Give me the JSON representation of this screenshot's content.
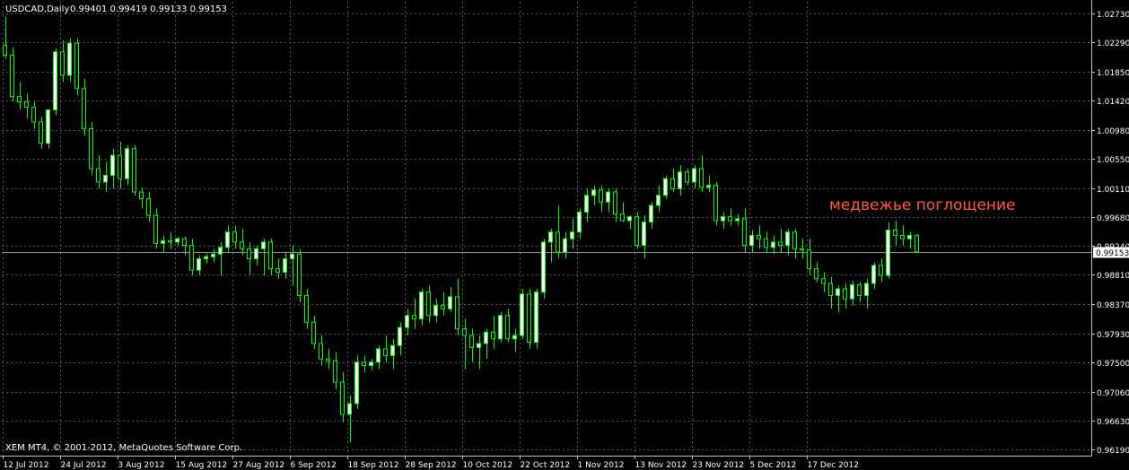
{
  "chart_data": {
    "type": "candlestick",
    "symbol_header": "USDCAD,Daily",
    "ohlc_header": "0.99401 0.99419 0.99133 0.99153",
    "current_price_label": "0.99153",
    "current_price": 0.99153,
    "ylim": [
      0.961,
      1.029
    ],
    "y_ticks": [
      {
        "value": 1.0273,
        "label": "1.02730"
      },
      {
        "value": 1.0229,
        "label": "1.02290"
      },
      {
        "value": 1.0185,
        "label": "1.01850"
      },
      {
        "value": 1.0142,
        "label": "1.01420"
      },
      {
        "value": 1.0098,
        "label": "1.00980"
      },
      {
        "value": 1.0055,
        "label": "1.00550"
      },
      {
        "value": 1.0011,
        "label": "1.00110"
      },
      {
        "value": 0.9968,
        "label": "0.99680"
      },
      {
        "value": 0.9924,
        "label": "0.99240"
      },
      {
        "value": 0.9881,
        "label": "0.98810"
      },
      {
        "value": 0.9837,
        "label": "0.98370"
      },
      {
        "value": 0.9793,
        "label": "0.97930"
      },
      {
        "value": 0.975,
        "label": "0.97500"
      },
      {
        "value": 0.9706,
        "label": "0.97060"
      },
      {
        "value": 0.9663,
        "label": "0.96630"
      },
      {
        "value": 0.9619,
        "label": "0.96190"
      }
    ],
    "x_ticks": [
      {
        "index": 0,
        "label": "12 Jul 2012"
      },
      {
        "index": 8,
        "label": "24 Jul 2012"
      },
      {
        "index": 16,
        "label": "3 Aug 2012"
      },
      {
        "index": 24,
        "label": "15 Aug 2012"
      },
      {
        "index": 32,
        "label": "27 Aug 2012"
      },
      {
        "index": 40,
        "label": "6 Sep 2012"
      },
      {
        "index": 48,
        "label": "18 Sep 2012"
      },
      {
        "index": 56,
        "label": "28 Sep 2012"
      },
      {
        "index": 64,
        "label": "10 Oct 2012"
      },
      {
        "index": 72,
        "label": "22 Oct 2012"
      },
      {
        "index": 80,
        "label": "1 Nov 2012"
      },
      {
        "index": 88,
        "label": "13 Nov 2012"
      },
      {
        "index": 96,
        "label": "23 Nov 2012"
      },
      {
        "index": 104,
        "label": "5 Dec 2012"
      },
      {
        "index": 112,
        "label": "17 Dec 2012"
      }
    ],
    "candles": [
      {
        "o": 1.0225,
        "h": 1.0268,
        "l": 1.0205,
        "c": 1.021
      },
      {
        "o": 1.021,
        "h": 1.0222,
        "l": 1.014,
        "c": 1.0148
      },
      {
        "o": 1.0148,
        "h": 1.017,
        "l": 1.0128,
        "c": 1.014
      },
      {
        "o": 1.014,
        "h": 1.0152,
        "l": 1.0115,
        "c": 1.0132
      },
      {
        "o": 1.0132,
        "h": 1.014,
        "l": 1.01,
        "c": 1.011
      },
      {
        "o": 1.011,
        "h": 1.0118,
        "l": 1.007,
        "c": 1.0078
      },
      {
        "o": 1.0078,
        "h": 1.012,
        "l": 1.007,
        "c": 1.0128
      },
      {
        "o": 1.0128,
        "h": 1.022,
        "l": 1.012,
        "c": 1.0215
      },
      {
        "o": 1.0215,
        "h": 1.0232,
        "l": 1.017,
        "c": 1.018
      },
      {
        "o": 1.018,
        "h": 1.0235,
        "l": 1.017,
        "c": 1.0228
      },
      {
        "o": 1.0228,
        "h": 1.0235,
        "l": 1.015,
        "c": 1.016
      },
      {
        "o": 1.016,
        "h": 1.0175,
        "l": 1.009,
        "c": 1.01
      },
      {
        "o": 1.01,
        "h": 1.011,
        "l": 1.003,
        "c": 1.004
      },
      {
        "o": 1.004,
        "h": 1.006,
        "l": 1.001,
        "c": 1.002
      },
      {
        "o": 1.002,
        "h": 1.005,
        "l": 1.0005,
        "c": 1.003
      },
      {
        "o": 1.003,
        "h": 1.007,
        "l": 1.001,
        "c": 1.006
      },
      {
        "o": 1.006,
        "h": 1.008,
        "l": 1.001,
        "c": 1.0025
      },
      {
        "o": 1.0025,
        "h": 1.0075,
        "l": 1.0015,
        "c": 1.007
      },
      {
        "o": 1.007,
        "h": 1.0075,
        "l": 1.0,
        "c": 1.0005
      },
      {
        "o": 1.0005,
        "h": 1.0012,
        "l": 0.998,
        "c": 0.9995
      },
      {
        "o": 0.9995,
        "h": 1.0005,
        "l": 0.996,
        "c": 0.997
      },
      {
        "o": 0.997,
        "h": 0.998,
        "l": 0.992,
        "c": 0.9928
      },
      {
        "o": 0.9928,
        "h": 0.994,
        "l": 0.9915,
        "c": 0.9932
      },
      {
        "o": 0.9932,
        "h": 0.9945,
        "l": 0.992,
        "c": 0.993
      },
      {
        "o": 0.993,
        "h": 0.9938,
        "l": 0.9925,
        "c": 0.9935
      },
      {
        "o": 0.9935,
        "h": 0.9938,
        "l": 0.991,
        "c": 0.9925
      },
      {
        "o": 0.9925,
        "h": 0.9935,
        "l": 0.988,
        "c": 0.9888
      },
      {
        "o": 0.9888,
        "h": 0.991,
        "l": 0.988,
        "c": 0.9905
      },
      {
        "o": 0.9905,
        "h": 0.9912,
        "l": 0.9898,
        "c": 0.9908
      },
      {
        "o": 0.9908,
        "h": 0.992,
        "l": 0.99,
        "c": 0.9912
      },
      {
        "o": 0.9912,
        "h": 0.993,
        "l": 0.988,
        "c": 0.9922
      },
      {
        "o": 0.9922,
        "h": 0.9955,
        "l": 0.9915,
        "c": 0.9945
      },
      {
        "o": 0.9945,
        "h": 0.9955,
        "l": 0.992,
        "c": 0.993
      },
      {
        "o": 0.993,
        "h": 0.995,
        "l": 0.991,
        "c": 0.992
      },
      {
        "o": 0.992,
        "h": 0.993,
        "l": 0.988,
        "c": 0.9905
      },
      {
        "o": 0.9905,
        "h": 0.9925,
        "l": 0.9895,
        "c": 0.992
      },
      {
        "o": 0.992,
        "h": 0.9935,
        "l": 0.988,
        "c": 0.993
      },
      {
        "o": 0.993,
        "h": 0.9935,
        "l": 0.988,
        "c": 0.989
      },
      {
        "o": 0.989,
        "h": 0.9905,
        "l": 0.9875,
        "c": 0.9885
      },
      {
        "o": 0.9885,
        "h": 0.9915,
        "l": 0.9875,
        "c": 0.9905
      },
      {
        "o": 0.9905,
        "h": 0.9925,
        "l": 0.9865,
        "c": 0.9912
      },
      {
        "o": 0.9912,
        "h": 0.992,
        "l": 0.984,
        "c": 0.985
      },
      {
        "o": 0.985,
        "h": 0.986,
        "l": 0.98,
        "c": 0.981
      },
      {
        "o": 0.981,
        "h": 0.982,
        "l": 0.977,
        "c": 0.9778
      },
      {
        "o": 0.9778,
        "h": 0.979,
        "l": 0.9745,
        "c": 0.9755
      },
      {
        "o": 0.9755,
        "h": 0.977,
        "l": 0.974,
        "c": 0.9752
      },
      {
        "o": 0.9752,
        "h": 0.9765,
        "l": 0.971,
        "c": 0.972
      },
      {
        "o": 0.972,
        "h": 0.9735,
        "l": 0.966,
        "c": 0.9672
      },
      {
        "o": 0.9672,
        "h": 0.97,
        "l": 0.963,
        "c": 0.9688
      },
      {
        "o": 0.9688,
        "h": 0.976,
        "l": 0.968,
        "c": 0.975
      },
      {
        "o": 0.975,
        "h": 0.976,
        "l": 0.9735,
        "c": 0.9745
      },
      {
        "o": 0.9745,
        "h": 0.9755,
        "l": 0.9738,
        "c": 0.975
      },
      {
        "o": 0.975,
        "h": 0.9775,
        "l": 0.974,
        "c": 0.977
      },
      {
        "o": 0.977,
        "h": 0.979,
        "l": 0.975,
        "c": 0.976
      },
      {
        "o": 0.976,
        "h": 0.9785,
        "l": 0.974,
        "c": 0.9775
      },
      {
        "o": 0.9775,
        "h": 0.981,
        "l": 0.976,
        "c": 0.9802
      },
      {
        "o": 0.9802,
        "h": 0.983,
        "l": 0.979,
        "c": 0.982
      },
      {
        "o": 0.982,
        "h": 0.9845,
        "l": 0.98,
        "c": 0.9815
      },
      {
        "o": 0.9815,
        "h": 0.986,
        "l": 0.9805,
        "c": 0.9855
      },
      {
        "o": 0.9855,
        "h": 0.9865,
        "l": 0.981,
        "c": 0.982
      },
      {
        "o": 0.982,
        "h": 0.9845,
        "l": 0.981,
        "c": 0.9835
      },
      {
        "o": 0.9835,
        "h": 0.9855,
        "l": 0.982,
        "c": 0.983
      },
      {
        "o": 0.983,
        "h": 0.9862,
        "l": 0.9825,
        "c": 0.9848
      },
      {
        "o": 0.9848,
        "h": 0.9875,
        "l": 0.979,
        "c": 0.98
      },
      {
        "o": 0.98,
        "h": 0.9815,
        "l": 0.974,
        "c": 0.979
      },
      {
        "o": 0.979,
        "h": 0.98,
        "l": 0.975,
        "c": 0.9772
      },
      {
        "o": 0.9772,
        "h": 0.979,
        "l": 0.974,
        "c": 0.9778
      },
      {
        "o": 0.9778,
        "h": 0.98,
        "l": 0.9755,
        "c": 0.9795
      },
      {
        "o": 0.9795,
        "h": 0.982,
        "l": 0.977,
        "c": 0.9785
      },
      {
        "o": 0.9785,
        "h": 0.9825,
        "l": 0.978,
        "c": 0.982
      },
      {
        "o": 0.982,
        "h": 0.983,
        "l": 0.978,
        "c": 0.9785
      },
      {
        "o": 0.9785,
        "h": 0.98,
        "l": 0.9765,
        "c": 0.979
      },
      {
        "o": 0.979,
        "h": 0.986,
        "l": 0.9785,
        "c": 0.9852
      },
      {
        "o": 0.9852,
        "h": 0.986,
        "l": 0.977,
        "c": 0.978
      },
      {
        "o": 0.978,
        "h": 0.986,
        "l": 0.977,
        "c": 0.9855
      },
      {
        "o": 0.9855,
        "h": 0.9935,
        "l": 0.9845,
        "c": 0.993
      },
      {
        "o": 0.993,
        "h": 0.995,
        "l": 0.99,
        "c": 0.9945
      },
      {
        "o": 0.9945,
        "h": 0.9985,
        "l": 0.9905,
        "c": 0.9915
      },
      {
        "o": 0.9915,
        "h": 0.9945,
        "l": 0.9905,
        "c": 0.9935
      },
      {
        "o": 0.9935,
        "h": 0.9965,
        "l": 0.992,
        "c": 0.9945
      },
      {
        "o": 0.9945,
        "h": 0.998,
        "l": 0.9935,
        "c": 0.9975
      },
      {
        "o": 0.9975,
        "h": 1.001,
        "l": 0.996,
        "c": 1.0
      },
      {
        "o": 1.0,
        "h": 1.0015,
        "l": 0.9985,
        "c": 1.0008
      },
      {
        "o": 1.0008,
        "h": 1.0015,
        "l": 0.9975,
        "c": 0.999
      },
      {
        "o": 0.999,
        "h": 1.001,
        "l": 0.9975,
        "c": 1.0005
      },
      {
        "o": 1.0005,
        "h": 1.001,
        "l": 0.996,
        "c": 0.9972
      },
      {
        "o": 0.9972,
        "h": 0.999,
        "l": 0.996,
        "c": 0.9962
      },
      {
        "o": 0.9962,
        "h": 0.997,
        "l": 0.995,
        "c": 0.9968
      },
      {
        "o": 0.9968,
        "h": 0.9975,
        "l": 0.992,
        "c": 0.9925
      },
      {
        "o": 0.9925,
        "h": 0.997,
        "l": 0.9905,
        "c": 0.996
      },
      {
        "o": 0.996,
        "h": 0.999,
        "l": 0.995,
        "c": 0.9985
      },
      {
        "o": 0.9985,
        "h": 1.0015,
        "l": 0.9975,
        "c": 1.0
      },
      {
        "o": 1.0,
        "h": 1.003,
        "l": 0.9995,
        "c": 1.0025
      },
      {
        "o": 1.0025,
        "h": 1.004,
        "l": 1.0005,
        "c": 1.001
      },
      {
        "o": 1.001,
        "h": 1.0045,
        "l": 1.0,
        "c": 1.0035
      },
      {
        "o": 1.0035,
        "h": 1.004,
        "l": 1.0015,
        "c": 1.002
      },
      {
        "o": 1.002,
        "h": 1.0045,
        "l": 1.001,
        "c": 1.004
      },
      {
        "o": 1.004,
        "h": 1.006,
        "l": 1.0005,
        "c": 1.0012
      },
      {
        "o": 1.0012,
        "h": 1.003,
        "l": 1.0005,
        "c": 1.0015
      },
      {
        "o": 1.0015,
        "h": 1.002,
        "l": 0.9955,
        "c": 0.9962
      },
      {
        "o": 0.9962,
        "h": 0.9975,
        "l": 0.995,
        "c": 0.9968
      },
      {
        "o": 0.9968,
        "h": 0.998,
        "l": 0.9955,
        "c": 0.9962
      },
      {
        "o": 0.9962,
        "h": 0.9972,
        "l": 0.9955,
        "c": 0.9965
      },
      {
        "o": 0.9965,
        "h": 0.998,
        "l": 0.9915,
        "c": 0.9925
      },
      {
        "o": 0.9925,
        "h": 0.9948,
        "l": 0.9915,
        "c": 0.994
      },
      {
        "o": 0.994,
        "h": 0.9955,
        "l": 0.992,
        "c": 0.9935
      },
      {
        "o": 0.9935,
        "h": 0.9945,
        "l": 0.9915,
        "c": 0.9922
      },
      {
        "o": 0.9922,
        "h": 0.994,
        "l": 0.9912,
        "c": 0.993
      },
      {
        "o": 0.993,
        "h": 0.995,
        "l": 0.9915,
        "c": 0.9925
      },
      {
        "o": 0.9925,
        "h": 0.995,
        "l": 0.991,
        "c": 0.9945
      },
      {
        "o": 0.9945,
        "h": 0.995,
        "l": 0.9905,
        "c": 0.992
      },
      {
        "o": 0.992,
        "h": 0.9935,
        "l": 0.9905,
        "c": 0.9918
      },
      {
        "o": 0.9918,
        "h": 0.9935,
        "l": 0.988,
        "c": 0.989
      },
      {
        "o": 0.989,
        "h": 0.99,
        "l": 0.987,
        "c": 0.9875
      },
      {
        "o": 0.9875,
        "h": 0.9885,
        "l": 0.9855,
        "c": 0.9868
      },
      {
        "o": 0.9868,
        "h": 0.9878,
        "l": 0.983,
        "c": 0.985
      },
      {
        "o": 0.985,
        "h": 0.9865,
        "l": 0.9825,
        "c": 0.986
      },
      {
        "o": 0.986,
        "h": 0.9868,
        "l": 0.983,
        "c": 0.9845
      },
      {
        "o": 0.9845,
        "h": 0.9872,
        "l": 0.9835,
        "c": 0.9866
      },
      {
        "o": 0.9866,
        "h": 0.987,
        "l": 0.984,
        "c": 0.985
      },
      {
        "o": 0.985,
        "h": 0.9875,
        "l": 0.983,
        "c": 0.9868
      },
      {
        "o": 0.9868,
        "h": 0.99,
        "l": 0.986,
        "c": 0.9895
      },
      {
        "o": 0.9895,
        "h": 0.9905,
        "l": 0.987,
        "c": 0.988
      },
      {
        "o": 0.988,
        "h": 0.996,
        "l": 0.9875,
        "c": 0.9948
      },
      {
        "o": 0.9948,
        "h": 0.9962,
        "l": 0.9925,
        "c": 0.994
      },
      {
        "o": 0.994,
        "h": 0.9955,
        "l": 0.9925,
        "c": 0.9935
      },
      {
        "o": 0.9935,
        "h": 0.9945,
        "l": 0.992,
        "c": 0.994
      },
      {
        "o": 0.99401,
        "h": 0.99419,
        "l": 0.99133,
        "c": 0.99153
      }
    ],
    "annotation": {
      "text": "медвежье поглощение",
      "color": "#ff5a3c",
      "anchor_index": 115,
      "anchor_price": 0.9978
    },
    "copyright": "XEM MT4, © 2001-2012, MetaQuotes Software Corp.",
    "colors": {
      "background": "#000000",
      "grid": "#4a5a66",
      "axis": "#c8c8c8",
      "text": "#ffffff",
      "bull_fill": "#ffffff",
      "bear_fill": "#000000",
      "candle_outline": "#00ff00",
      "price_line": "#8c8c8c",
      "price_label_bg": "#ffffff",
      "price_label_text": "#000000"
    },
    "grid": true
  }
}
